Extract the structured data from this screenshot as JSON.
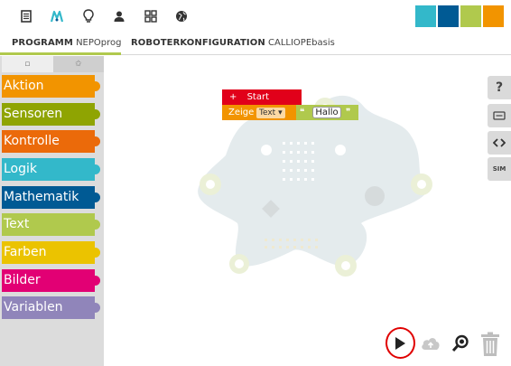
{
  "topbar": {
    "icons": [
      "document-icon",
      "robot-icon",
      "lightbulb-icon",
      "user-icon",
      "grid-icon",
      "globe-icon"
    ],
    "logo_colors": [
      "#33b8ca",
      "#005a94",
      "#b0c94d",
      "#f29400"
    ]
  },
  "tabs": {
    "program_label": "PROGRAMM",
    "program_name": "NEPOprog",
    "config_label": "ROBOTERKONFIGURATION",
    "config_name": "CALLIOPEbasis"
  },
  "toolbox": {
    "tab_left_glyph": "▫",
    "tab_right_glyph": "✩",
    "categories": [
      {
        "label": "Aktion",
        "color": "#f29400"
      },
      {
        "label": "Sensoren",
        "color": "#8fa402"
      },
      {
        "label": "Kontrolle",
        "color": "#eb6a0a"
      },
      {
        "label": "Logik",
        "color": "#33b8ca"
      },
      {
        "label": "Mathematik",
        "color": "#005a94"
      },
      {
        "label": "Text",
        "color": "#b0c94d"
      },
      {
        "label": "Farben",
        "color": "#ebc300"
      },
      {
        "label": "Bilder",
        "color": "#e20074"
      },
      {
        "label": "Variablen",
        "color": "#9085ba"
      }
    ]
  },
  "blocks": {
    "start_label": "Start",
    "start_plus": "+",
    "show_label": "Zeige",
    "show_dropdown": "Text",
    "show_dropdown_arrow": "▾",
    "text_open_quote": "❝",
    "text_value": "Hallo",
    "text_close_quote": "❞"
  },
  "side_buttons": [
    "?",
    "SIM"
  ],
  "bottom": {
    "run_icon": "play-icon",
    "upload_icon": "cloud-upload-icon",
    "zoom_icon": "zoom-icon",
    "trash_icon": "trash-icon"
  }
}
